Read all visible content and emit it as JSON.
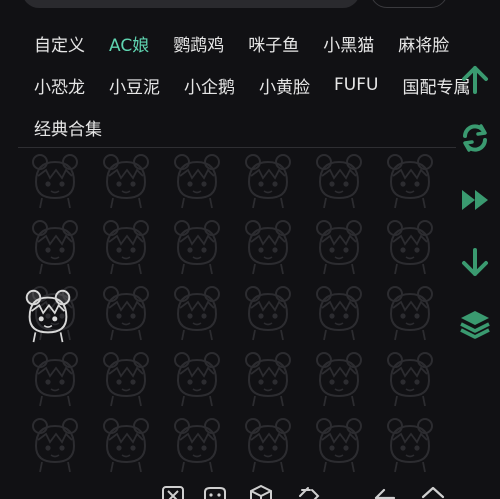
{
  "tabs": [
    [
      "自定义",
      "AC娘",
      "鹦鹉鸡",
      "咪子鱼",
      "小黑猫",
      "麻将脸"
    ],
    [
      "小恐龙",
      "小豆泥",
      "小企鹅",
      "小黄脸",
      "FUFU",
      "国配专属"
    ],
    [
      "经典合集"
    ]
  ],
  "active_tab": "AC娘",
  "colors": {
    "accent": "#5fd4b0",
    "icon_green": "#3a9a70",
    "background": "#111114",
    "text": "#e6e6e6"
  },
  "right_actions": [
    "arrow-up-icon",
    "refresh-icon",
    "fast-forward-icon",
    "arrow-down-icon",
    "layers-icon"
  ],
  "bottom_icons": [
    "kaomoji-icon",
    "emoji-face-icon",
    "dice-icon",
    "clipboard-icon",
    "back-arrow-icon",
    "home-icon"
  ],
  "sticker_rows": 5,
  "sticker_cols": 6
}
